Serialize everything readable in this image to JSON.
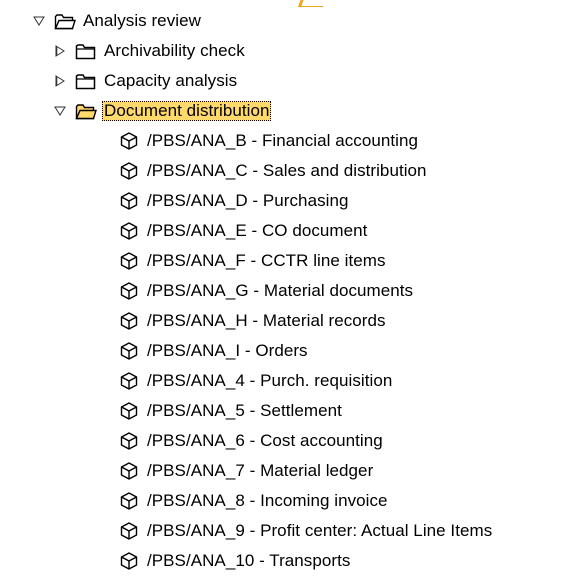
{
  "colors": {
    "selection_bg": "#ffd96b",
    "accent": "#f4a21a"
  },
  "tree": {
    "root": {
      "label": "Analysis review",
      "expander_icon": "triangle-down-icon",
      "folder_icon": "folder-open-icon"
    },
    "folders": [
      {
        "label": "Archivability check",
        "expanded": false
      },
      {
        "label": "Capacity analysis",
        "expanded": false
      },
      {
        "label": "Document distribution",
        "expanded": true,
        "selected": true
      }
    ],
    "items": [
      "/PBS/ANA_B - Financial accounting",
      "/PBS/ANA_C - Sales and distribution",
      "/PBS/ANA_D - Purchasing",
      "/PBS/ANA_E - CO document",
      "/PBS/ANA_F - CCTR line items",
      "/PBS/ANA_G - Material documents",
      "/PBS/ANA_H - Material records",
      "/PBS/ANA_I - Orders",
      "/PBS/ANA_4 - Purch. requisition",
      "/PBS/ANA_5 - Settlement",
      "/PBS/ANA_6 - Cost accounting",
      "/PBS/ANA_7 - Material ledger",
      "/PBS/ANA_8 - Incoming invoice",
      "/PBS/ANA_9 - Profit center: Actual Line Items",
      "/PBS/ANA_10 - Transports"
    ]
  }
}
